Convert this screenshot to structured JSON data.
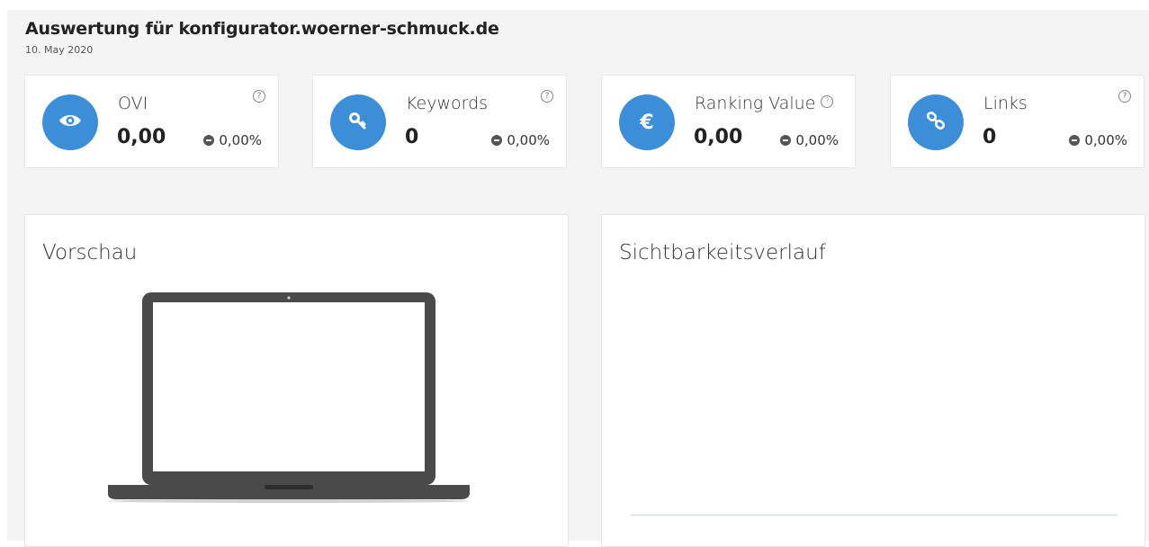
{
  "header": {
    "title": "Auswertung für konfigurator.woerner-schmuck.de",
    "date": "10. May 2020"
  },
  "kpis": [
    {
      "label": "OVI",
      "value": "0,00",
      "change": "0,00%",
      "icon": "eye-icon"
    },
    {
      "label": "Keywords",
      "value": "0",
      "change": "0,00%",
      "icon": "key-icon"
    },
    {
      "label": "Ranking Value",
      "value": "0,00",
      "change": "0,00%",
      "icon": "euro-icon"
    },
    {
      "label": "Links",
      "value": "0",
      "change": "0,00%",
      "icon": "link-icon"
    }
  ],
  "help_symbol": "?",
  "panels": {
    "preview_title": "Vorschau",
    "visibility_title": "Sichtbarkeitsverlauf"
  },
  "colors": {
    "accent": "#3d8ed9",
    "background": "#f4f4f4",
    "laptop": "#4a4a4a"
  }
}
